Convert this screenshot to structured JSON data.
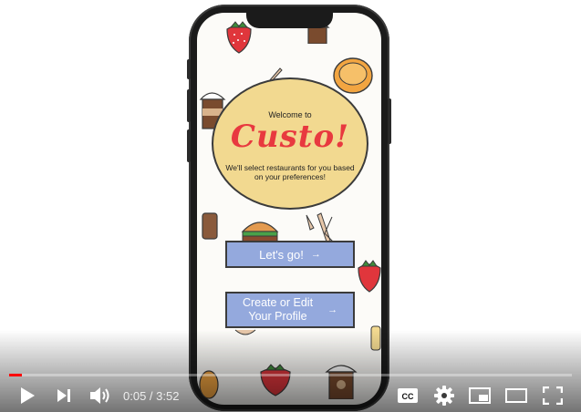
{
  "app": {
    "welcome_text": "Welcome to",
    "brand_name": "Custo!",
    "tagline": "We'll select restaurants for you based on your preferences!",
    "primary_button": "Let's go!",
    "secondary_button_line1": "Create or Edit",
    "secondary_button_line2": "Your Profile",
    "colors": {
      "oval": "#f2d990",
      "brand": "#e8393f",
      "button": "#94a9dd",
      "background": "#fcfbf8"
    },
    "decorations": [
      "strawberry-icon",
      "donut-icon",
      "burger-icon",
      "coffee-cup-icon",
      "cutlery-icon",
      "bread-icon"
    ]
  },
  "player": {
    "current_time": "0:05",
    "separator": " / ",
    "duration": "3:52",
    "progress": 0.022,
    "accent_color": "#ff0000",
    "controls": [
      "play-icon",
      "next-icon",
      "volume-icon",
      "cc-icon",
      "settings-icon",
      "miniplayer-icon",
      "theater-icon",
      "fullscreen-icon"
    ],
    "cc_label": "CC"
  }
}
